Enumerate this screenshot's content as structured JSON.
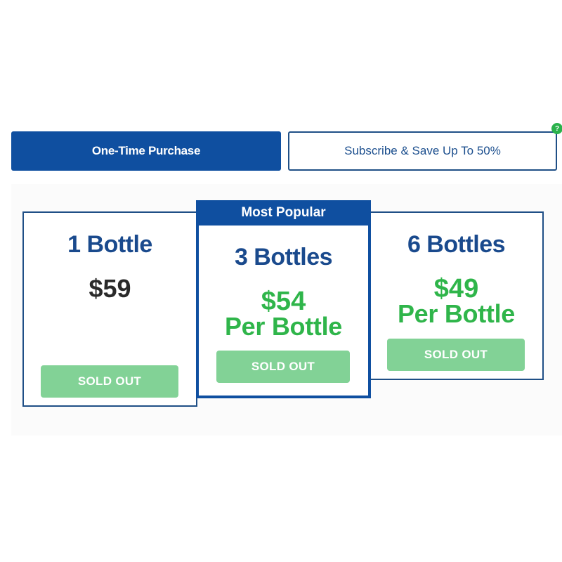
{
  "tabs": {
    "one_time": "One-Time Purchase",
    "subscribe": "Subscribe & Save Up To 50%",
    "help_badge": "?"
  },
  "offers": [
    {
      "title": "1 Bottle",
      "price": "$59",
      "per_label": "",
      "button": "SOLD OUT"
    },
    {
      "banner": "Most Popular",
      "title": "3 Bottles",
      "price": "$54",
      "per_label": "Per Bottle",
      "button": "SOLD OUT"
    },
    {
      "title": "6 Bottles",
      "price": "$49",
      "per_label": "Per Bottle",
      "button": "SOLD OUT"
    }
  ],
  "colors": {
    "brand_blue": "#0f4fa0",
    "price_green": "#2fb54a",
    "button_green": "#82d296",
    "help_badge_green": "#2bb24c"
  }
}
